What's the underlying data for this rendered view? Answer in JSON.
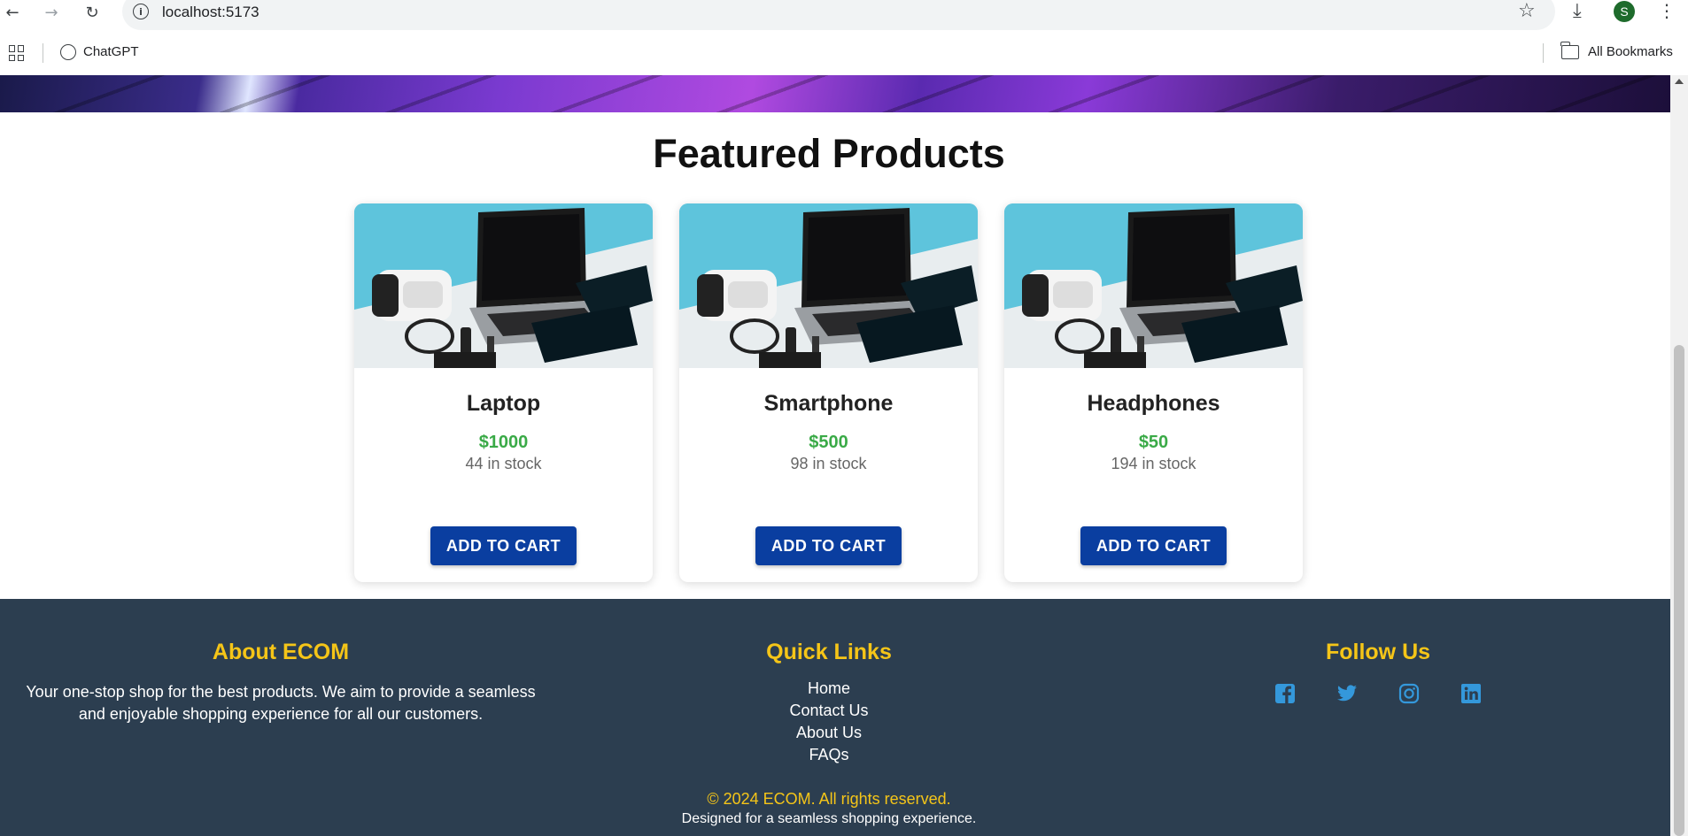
{
  "browser": {
    "url": "localhost:5173",
    "profile_initial": "S",
    "bookmarks": [
      {
        "label": "ChatGPT"
      }
    ],
    "all_bookmarks_label": "All Bookmarks"
  },
  "featured": {
    "title": "Featured Products",
    "products": [
      {
        "name": "Laptop",
        "price": "$1000",
        "stock": "44 in stock",
        "button_label": "ADD TO CART"
      },
      {
        "name": "Smartphone",
        "price": "$500",
        "stock": "98 in stock",
        "button_label": "ADD TO CART"
      },
      {
        "name": "Headphones",
        "price": "$50",
        "stock": "194 in stock",
        "button_label": "ADD TO CART"
      }
    ]
  },
  "footer": {
    "about": {
      "heading": "About ECOM",
      "text": "Your one-stop shop for the best products. We aim to provide a seamless and enjoyable shopping experience for all our customers."
    },
    "quick_links": {
      "heading": "Quick Links",
      "links": [
        "Home",
        "Contact Us",
        "About Us",
        "FAQs"
      ]
    },
    "follow": {
      "heading": "Follow Us",
      "icons": [
        "facebook-icon",
        "twitter-icon",
        "instagram-icon",
        "linkedin-icon"
      ]
    },
    "copyright": "© 2024 ECOM. All rights reserved.",
    "tagline": "Designed for a seamless shopping experience."
  },
  "colors": {
    "footer_bg": "#2c3e50",
    "footer_heading": "#f5c518",
    "price": "#3aaa47",
    "button": "#0a3ea0",
    "social_icon": "#3498db"
  }
}
